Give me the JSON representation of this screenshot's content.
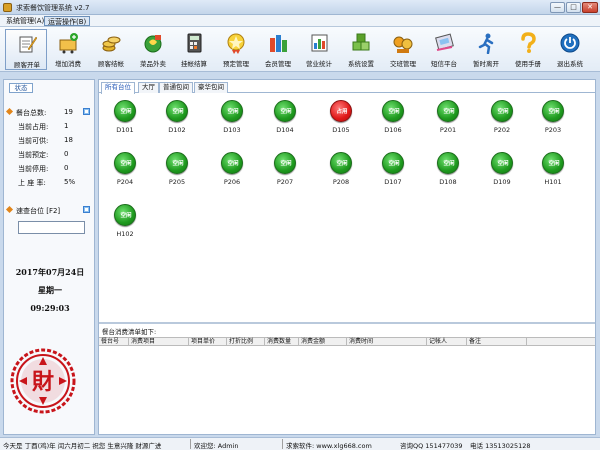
{
  "window": {
    "title": "求索餐饮管理系统 v2.7",
    "min": "—",
    "max": "□",
    "close": "✕"
  },
  "menu": [
    {
      "label": "系统管理(A)",
      "active": false
    },
    {
      "label": "运营操作(B)",
      "active": true
    }
  ],
  "toolbar": [
    {
      "label": "顾客开单",
      "icon": "pen-notepad-icon"
    },
    {
      "label": "增加消费",
      "icon": "add-cart-icon"
    },
    {
      "label": "顾客结帐",
      "icon": "coins-icon"
    },
    {
      "label": "菜品外卖",
      "icon": "takeout-bag-icon"
    },
    {
      "label": "挂帐结算",
      "icon": "calculator-icon"
    },
    {
      "label": "预定管理",
      "icon": "star-badge-icon"
    },
    {
      "label": "会员管理",
      "icon": "members-icon"
    },
    {
      "label": "营业统计",
      "icon": "bar-chart-icon"
    },
    {
      "label": "系统设置",
      "icon": "cubes-icon"
    },
    {
      "label": "交班管理",
      "icon": "handover-icon"
    },
    {
      "label": "短信平台",
      "icon": "sms-phone-icon"
    },
    {
      "label": "暂时离开",
      "icon": "running-man-icon"
    },
    {
      "label": "使用手册",
      "icon": "help-question-icon"
    },
    {
      "label": "退出系统",
      "icon": "power-icon"
    }
  ],
  "left": {
    "tab": "状态",
    "stats_title": "餐台总数:",
    "stats_total": "19",
    "stats": [
      {
        "label": "当前占用:",
        "value": "1"
      },
      {
        "label": "当前可供:",
        "value": "18"
      },
      {
        "label": "当前预定:",
        "value": "0"
      },
      {
        "label": "当前停用:",
        "value": "0"
      },
      {
        "label": "上 座 率:",
        "value": "5%"
      }
    ],
    "quick_title": "速查台位 [F2]",
    "quick_value": "",
    "date": "2017年07月24日",
    "weekday": "星期一",
    "time": "09:29:03",
    "seal_text": "財"
  },
  "tabs": [
    "所有台位",
    "大厅",
    "普通包间",
    "豪华包间"
  ],
  "tables": [
    {
      "name": "D101",
      "state": "空闲",
      "busy": false
    },
    {
      "name": "D102",
      "state": "空闲",
      "busy": false
    },
    {
      "name": "D103",
      "state": "空闲",
      "busy": false
    },
    {
      "name": "D104",
      "state": "空闲",
      "busy": false
    },
    {
      "name": "D105",
      "state": "占用",
      "busy": true
    },
    {
      "name": "D106",
      "state": "空闲",
      "busy": false
    },
    {
      "name": "P201",
      "state": "空闲",
      "busy": false
    },
    {
      "name": "P202",
      "state": "空闲",
      "busy": false
    },
    {
      "name": "P203",
      "state": "空闲",
      "busy": false
    },
    {
      "name": "P204",
      "state": "空闲",
      "busy": false
    },
    {
      "name": "P205",
      "state": "空闲",
      "busy": false
    },
    {
      "name": "P206",
      "state": "空闲",
      "busy": false
    },
    {
      "name": "P207",
      "state": "空闲",
      "busy": false
    },
    {
      "name": "P208",
      "state": "空闲",
      "busy": false
    },
    {
      "name": "D107",
      "state": "空闲",
      "busy": false
    },
    {
      "name": "D108",
      "state": "空闲",
      "busy": false
    },
    {
      "name": "D109",
      "state": "空闲",
      "busy": false
    },
    {
      "name": "H101",
      "state": "空闲",
      "busy": false
    },
    {
      "name": "H102",
      "state": "空闲",
      "busy": false
    }
  ],
  "consumption": {
    "title": "餐台消费清单如下:",
    "columns": [
      "餐台号",
      "消费项目",
      "项目单价",
      "打折比例",
      "消费数量",
      "消费金额",
      "消费时间",
      "记帐人",
      "备注"
    ]
  },
  "status": {
    "today": "今天是 丁酉(鸡)年 闰六月初二 祝您 生意兴隆 财源广进",
    "welcome": "欢迎您: Admin",
    "site": "求索软件: www.xlg668.com",
    "qq": "咨询QQ 151477039",
    "phone": "电话 13513025128"
  },
  "colors": {
    "free": "#1f9a1f",
    "busy": "#e01818",
    "accent": "#1f55b5",
    "seal": "#c8141a"
  }
}
